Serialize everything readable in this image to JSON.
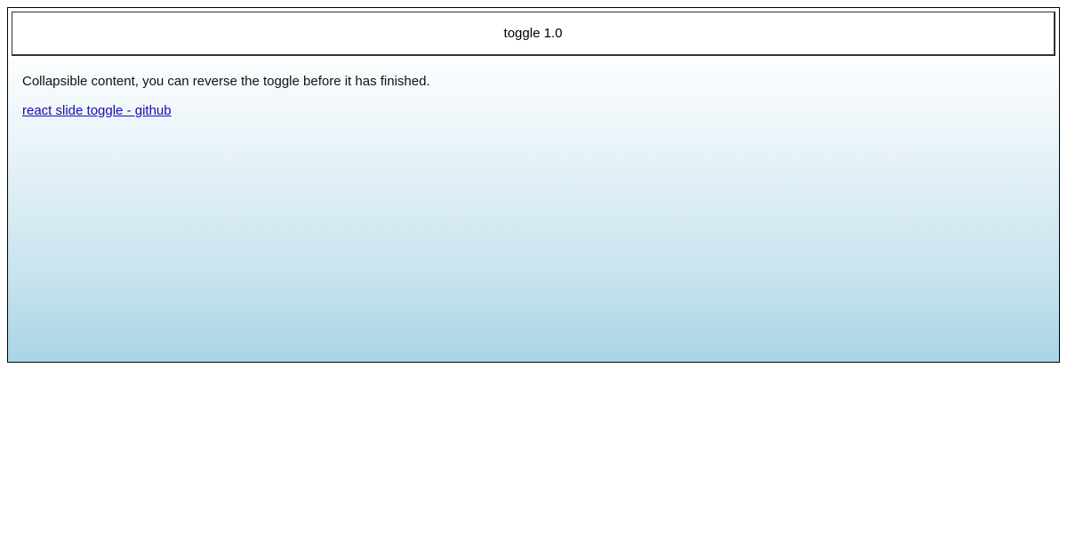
{
  "toggle": {
    "button_label": "toggle 1.0"
  },
  "panel": {
    "description": "Collapsible content, you can reverse the toggle before it has finished.",
    "link_text": "react slide toggle - github"
  }
}
